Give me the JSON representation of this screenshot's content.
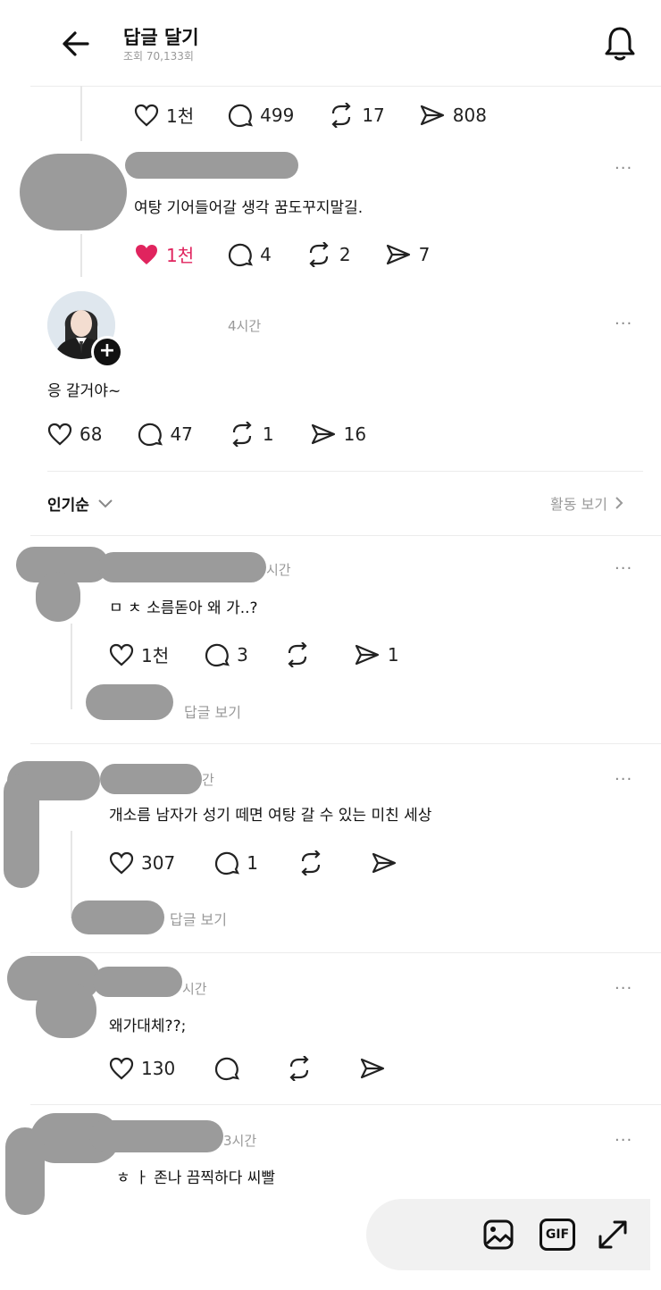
{
  "header": {
    "title": "답글 달기",
    "views": "조회 70,133회"
  },
  "post_actions": {
    "likes": "1천",
    "replies": "499",
    "reposts": "17",
    "shares": "808"
  },
  "reply1": {
    "text": "여탕 기어들어갈 생각 꿈도꾸지말길.",
    "likes": "1천",
    "replies": "4",
    "reposts": "2",
    "shares": "7",
    "more": "···"
  },
  "reply2": {
    "time": "4시간",
    "text": "응 갈거야~",
    "likes": "68",
    "replies": "47",
    "reposts": "1",
    "shares": "16",
    "more": "···"
  },
  "sort": {
    "label": "인기순",
    "activity": "활동 보기"
  },
  "comments": [
    {
      "time": "시간",
      "text": "ㅁ ㅊ 소름돋아 왜 가..?",
      "likes": "1천",
      "replies": "3",
      "reposts": "",
      "shares": "1",
      "view_replies": "답글 보기",
      "more": "···"
    },
    {
      "time": "간",
      "text": "개소름 남자가 성기 떼면 여탕 갈 수 있는 미친 세상",
      "likes": "307",
      "replies": "1",
      "reposts": "",
      "shares": "",
      "view_replies": "답글 보기",
      "more": "···"
    },
    {
      "time": "시간",
      "text": "왜가대체??;",
      "likes": "130",
      "replies": "",
      "reposts": "",
      "shares": "",
      "more": "···"
    },
    {
      "time": "3시간",
      "text": "ㅎ ㅏ 존나 끔찍하다 씨빨",
      "more": "···"
    }
  ],
  "composer": {
    "gif_label": "GIF"
  },
  "colors": {
    "like_active": "#e0245e",
    "redaction": "#9b9b9b"
  }
}
